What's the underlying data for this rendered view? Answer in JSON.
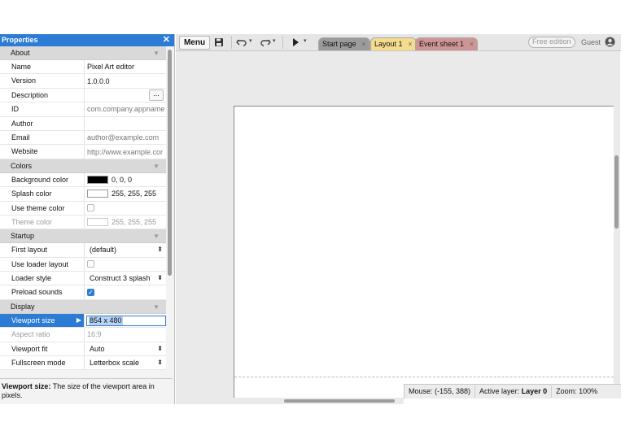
{
  "properties_panel": {
    "title": "Properties",
    "close_glyph": "✕",
    "sections": {
      "about": "About",
      "colors": "Colors",
      "startup": "Startup",
      "display": "Display"
    },
    "about": {
      "name": {
        "label": "Name",
        "value": "Pixel Art editor"
      },
      "version": {
        "label": "Version",
        "value": "1.0.0.0"
      },
      "description": {
        "label": "Description",
        "value": "",
        "button": "..."
      },
      "id": {
        "label": "ID",
        "value": "com.company.appname"
      },
      "author": {
        "label": "Author",
        "value": ""
      },
      "email": {
        "label": "Email",
        "value": "author@example.com"
      },
      "website": {
        "label": "Website",
        "value": "http://www.example.cor"
      }
    },
    "colors": {
      "background_color": {
        "label": "Background color",
        "value": "0, 0, 0",
        "swatch": "#000000"
      },
      "splash_color": {
        "label": "Splash color",
        "value": "255, 255, 255",
        "swatch": "#ffffff"
      },
      "use_theme_color": {
        "label": "Use theme color",
        "checked": false
      },
      "theme_color": {
        "label": "Theme color",
        "value": "255, 255, 255",
        "swatch": "#ffffff"
      }
    },
    "startup": {
      "first_layout": {
        "label": "First layout",
        "value": "(default)"
      },
      "use_loader_layout": {
        "label": "Use loader layout",
        "checked": false
      },
      "loader_style": {
        "label": "Loader style",
        "value": "Construct 3 splash"
      },
      "preload_sounds": {
        "label": "Preload sounds",
        "checked": true
      }
    },
    "display": {
      "viewport_size": {
        "label": "Viewport size",
        "value": "854 x 480"
      },
      "aspect_ratio": {
        "label": "Aspect ratio",
        "value": "16:9"
      },
      "viewport_fit": {
        "label": "Viewport fit",
        "value": "Auto"
      },
      "fullscreen_mode": {
        "label": "Fullscreen mode",
        "value": "Letterbox scale"
      }
    },
    "help": {
      "term": "Viewport size:",
      "text": "The size of the viewport area in pixels."
    }
  },
  "toolbar": {
    "menu_label": "Menu",
    "tabs": [
      {
        "label": "Start page",
        "close": "×"
      },
      {
        "label": "Layout 1",
        "close": "×"
      },
      {
        "label": "Event sheet 1",
        "close": "×"
      }
    ],
    "edition_badge": "Free edition",
    "user_label": "Guest"
  },
  "status_bar": {
    "mouse": "Mouse: (-155, 388)",
    "active_layer_label": "Active layer:",
    "active_layer_value": "Layer 0",
    "zoom": "Zoom: 100%"
  },
  "colors": {
    "accent": "#2c7cd6",
    "tab_start": "#9b9b9b",
    "tab_layout": "#f4dc8e",
    "tab_event": "#cf9595"
  }
}
